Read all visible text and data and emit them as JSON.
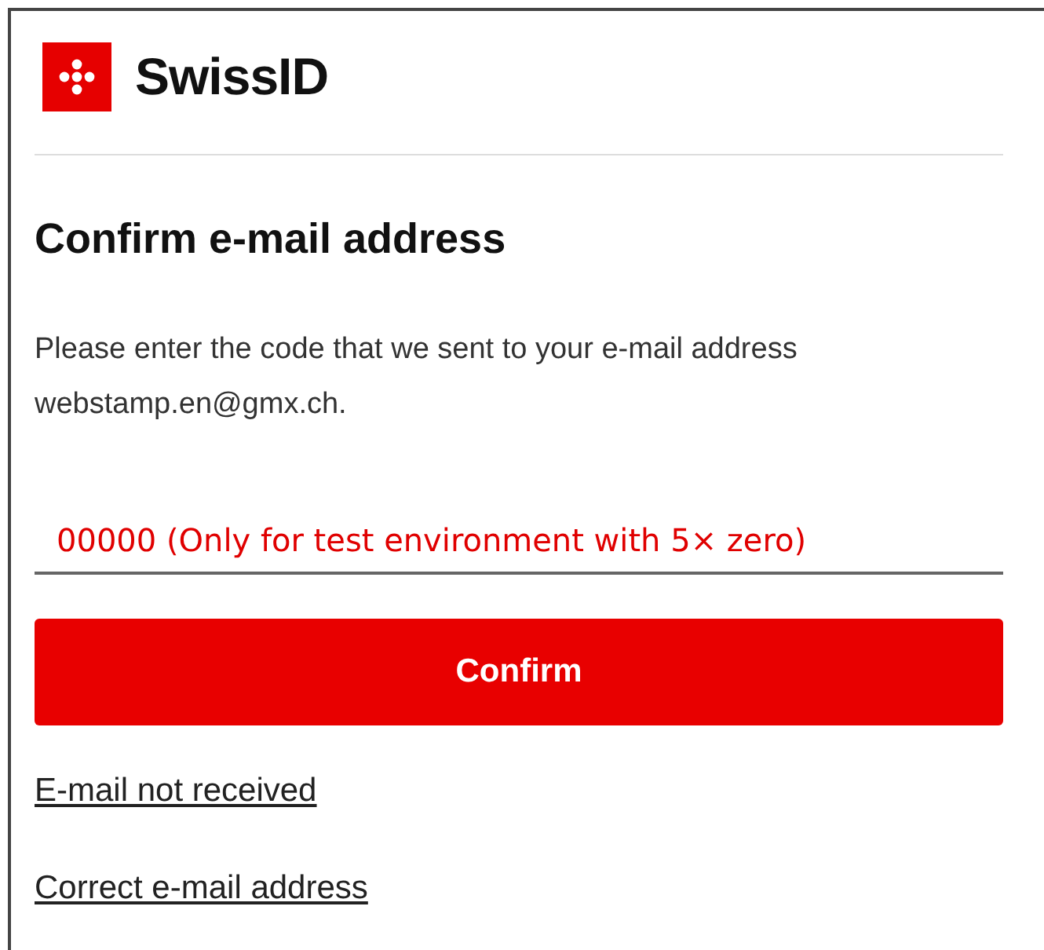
{
  "brand": {
    "name": "SwissID"
  },
  "heading": "Confirm e-mail address",
  "message": "Please enter the code that we sent to your e-mail address webstamp.en@gmx.ch.",
  "code_field": {
    "value": "00000 (Only for test environment with 5× zero)"
  },
  "buttons": [
    {
      "label": "Confirm"
    }
  ],
  "links": [
    "E-mail not received",
    "Correct e-mail address"
  ]
}
